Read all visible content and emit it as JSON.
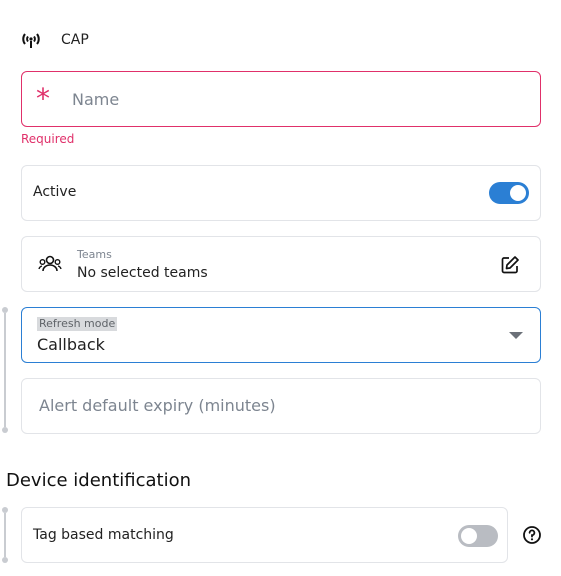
{
  "header": {
    "title": "CAP",
    "icon": "wifi-tethering-icon"
  },
  "name_field": {
    "placeholder": "Name",
    "required_marker": "*",
    "error": "Required"
  },
  "active": {
    "label": "Active",
    "enabled": true
  },
  "teams": {
    "caption": "Teams",
    "value": "No selected teams",
    "icon": "people-icon",
    "edit_icon": "edit-icon"
  },
  "refresh_mode": {
    "caption": "Refresh mode",
    "value": "Callback"
  },
  "alert_expiry": {
    "placeholder": "Alert default expiry (minutes)"
  },
  "device_identification": {
    "title": "Device identification",
    "tag_matching": {
      "label": "Tag based matching",
      "enabled": false
    },
    "help_icon": "help-circle-icon"
  },
  "colors": {
    "accent": "#2b7fd4",
    "error": "#e0306a",
    "border": "#e2e4e8"
  }
}
